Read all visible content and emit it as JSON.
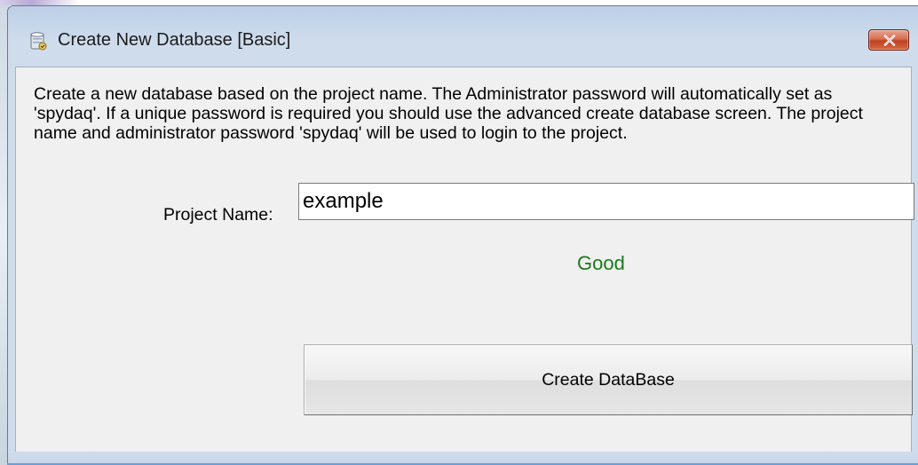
{
  "window": {
    "title": "Create New Database [Basic]",
    "icon": "database-icon",
    "close_icon": "close-icon"
  },
  "content": {
    "description": "Create a new database based on the project name. The Administrator password will automatically set as 'spydaq'. If a unique password is required you should use the advanced create database screen. The project name and administrator password 'spydaq' will be used to login to the project.",
    "project_name_label": "Project Name:",
    "project_name_value": "example",
    "status_text": "Good",
    "create_button_label": "Create DataBase"
  },
  "colors": {
    "status_good": "#1a7a1a",
    "close_button": "#c2401f",
    "titlebar": "#c5d6ea",
    "client_background": "#f0f0f0"
  }
}
